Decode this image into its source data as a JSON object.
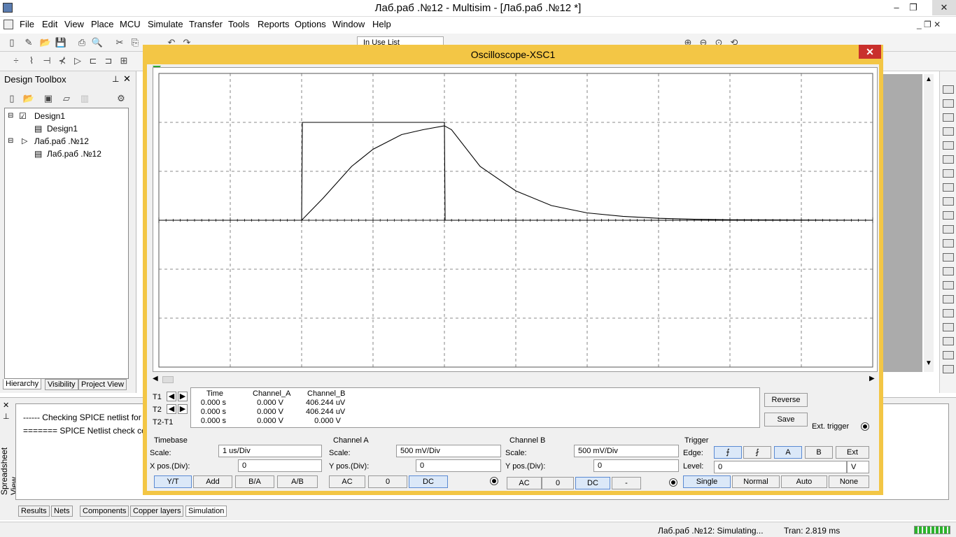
{
  "window": {
    "title": "Лаб.раб .№12 - Multisim - [Лаб.раб .№12 *]",
    "minimize": "‒",
    "restore": "❐",
    "close": "✕"
  },
  "menu": [
    "File",
    "Edit",
    "View",
    "Place",
    "MCU",
    "Simulate",
    "Transfer",
    "Tools",
    "Reports",
    "Options",
    "Window",
    "Help"
  ],
  "toolbar": {
    "in_use_list": "In Use List"
  },
  "design_toolbox": {
    "title": "Design Toolbox",
    "tree": [
      {
        "label": "Design1",
        "level": 0
      },
      {
        "label": "Design1",
        "level": 1
      },
      {
        "label": "Лаб.раб .№12",
        "level": 0
      },
      {
        "label": "Лаб.раб .№12",
        "level": 1
      }
    ],
    "tabs": [
      "Hierarchy",
      "Visibility",
      "Project View"
    ]
  },
  "spreadsheet": {
    "label": "Spreadsheet View",
    "messages": [
      "------ Checking SPICE netlist for",
      "======= SPICE Netlist check co"
    ],
    "tabs": [
      "Results",
      "Nets",
      "Components",
      "Copper layers",
      "Simulation"
    ]
  },
  "status": {
    "simulating": "Лаб.раб .№12: Simulating...",
    "tran": "Tran: 2.819 ms"
  },
  "oscilloscope": {
    "title": "Oscilloscope-XSC1",
    "readout_headers": [
      "Time",
      "Channel_A",
      "Channel_B"
    ],
    "readout_rows": [
      {
        "label": "T1",
        "time": "0.000 s",
        "a": "0.000 V",
        "b": "406.244 uV"
      },
      {
        "label": "T2",
        "time": "0.000 s",
        "a": "0.000 V",
        "b": "406.244 uV"
      },
      {
        "label": "T2-T1",
        "time": "0.000 s",
        "a": "0.000 V",
        "b": "0.000 V"
      }
    ],
    "reverse": "Reverse",
    "save": "Save",
    "ext_trigger": "Ext. trigger",
    "timebase": {
      "title": "Timebase",
      "scale_label": "Scale:",
      "scale": "1 us/Div",
      "xpos_label": "X pos.(Div):",
      "xpos": "0",
      "buttons": [
        "Y/T",
        "Add",
        "B/A",
        "A/B"
      ]
    },
    "channel_a": {
      "title": "Channel A",
      "scale_label": "Scale:",
      "scale": "500 mV/Div",
      "ypos_label": "Y pos.(Div):",
      "ypos": "0",
      "buttons": [
        "AC",
        "0",
        "DC"
      ]
    },
    "channel_b": {
      "title": "Channel B",
      "scale_label": "Scale:",
      "scale": "500 mV/Div",
      "ypos_label": "Y pos.(Div):",
      "ypos": "0",
      "buttons": [
        "AC",
        "0",
        "DC",
        "-"
      ]
    },
    "trigger": {
      "title": "Trigger",
      "edge_label": "Edge:",
      "level_label": "Level:",
      "level": "0",
      "unit": "V",
      "sources": [
        "A",
        "B",
        "Ext"
      ],
      "modes": [
        "Single",
        "Normal",
        "Auto",
        "None"
      ]
    }
  },
  "chart_data": {
    "type": "line",
    "xlabel": "",
    "ylabel": "",
    "xlim": [
      0,
      10
    ],
    "ylim": [
      -3,
      3
    ],
    "x_unit": "div",
    "y_unit": "div",
    "grid": true,
    "series": [
      {
        "color": "#000000",
        "x": [
          0,
          2.0,
          2.01,
          4.0,
          4.01,
          10.0
        ],
        "y": [
          0,
          0,
          2.0,
          2.0,
          0,
          0
        ]
      },
      {
        "color": "#000000",
        "x": [
          0,
          2.0,
          2.3,
          2.7,
          3.0,
          3.4,
          3.7,
          4.0,
          4.1,
          4.5,
          5.0,
          5.5,
          6.0,
          6.5,
          7.0,
          7.5,
          8.0,
          10.0
        ],
        "y": [
          0,
          0,
          0.45,
          1.1,
          1.45,
          1.75,
          1.85,
          1.93,
          1.85,
          1.1,
          0.6,
          0.3,
          0.15,
          0.08,
          0.04,
          0.02,
          0.01,
          0
        ]
      }
    ]
  }
}
